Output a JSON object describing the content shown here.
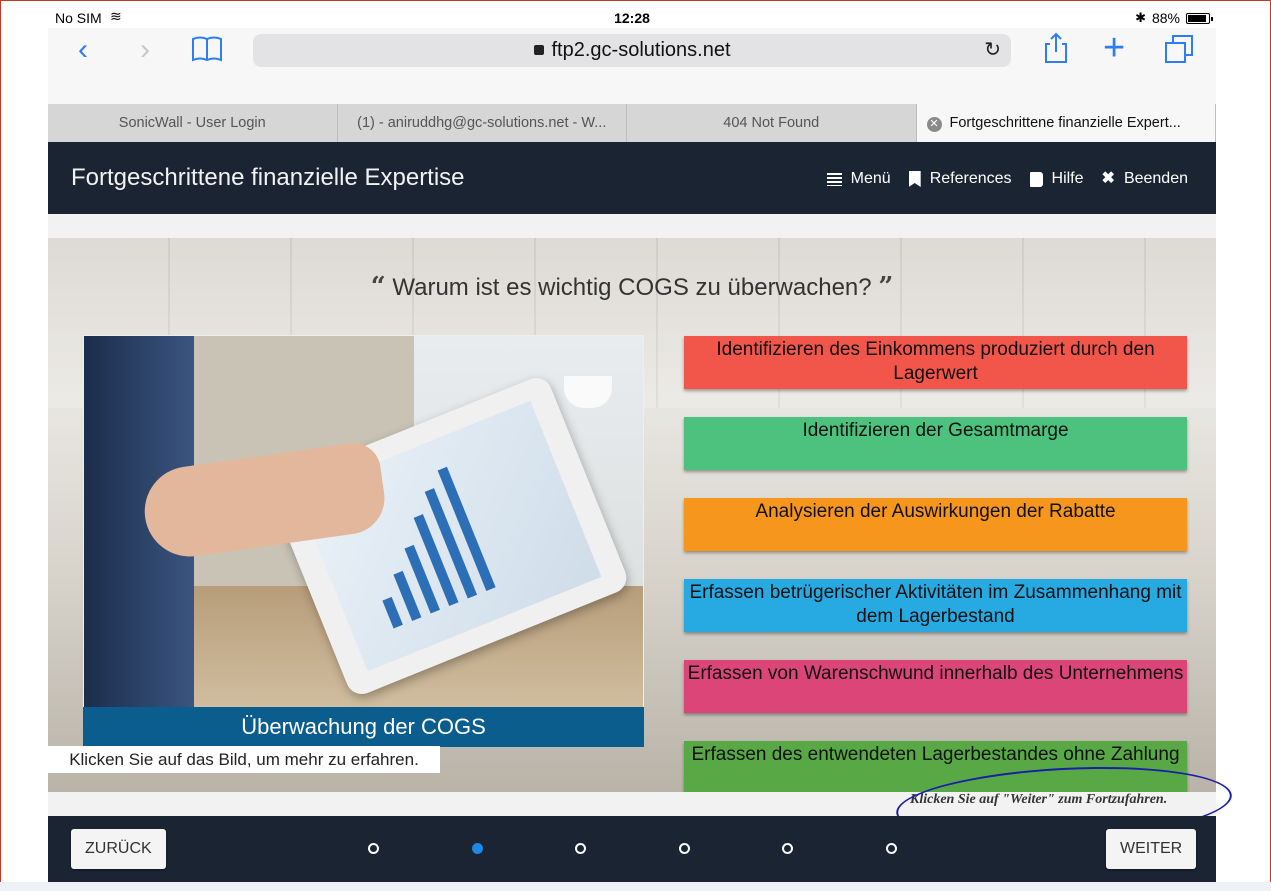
{
  "status_bar": {
    "carrier": "No SIM",
    "time": "12:28",
    "battery": "88%"
  },
  "browser": {
    "url": "ftp2.gc-solutions.net",
    "tabs": [
      {
        "label": "SonicWall - User Login",
        "active": false
      },
      {
        "label": "(1) - aniruddhg@gc-solutions.net - W...",
        "active": false
      },
      {
        "label": "404 Not Found",
        "active": false
      },
      {
        "label": "Fortgeschrittene finanzielle Expert...",
        "active": true
      }
    ]
  },
  "course": {
    "title": "Fortgeschrittene finanzielle Expertise",
    "nav": {
      "menu": "Menü",
      "references": "References",
      "help": "Hilfe",
      "exit": "Beenden"
    }
  },
  "slide": {
    "question": "Warum ist es wichtig COGS zu überwachen?",
    "image_caption": "Überwachung der COGS",
    "image_hint": "Klicken Sie auf das Bild, um mehr zu erfahren.",
    "options": [
      {
        "label": "Identifizieren des Einkommens produziert durch den Lagerwert",
        "color": "#f2564a"
      },
      {
        "label": "Identifizieren der Gesamtmarge",
        "color": "#4cc27e"
      },
      {
        "label": "Analysieren der Auswirkungen der Rabatte",
        "color": "#f7961d"
      },
      {
        "label": "Erfassen betrügerischer Aktivitäten im Zusammenhang mit dem Lagerbestand",
        "color": "#27a9e1"
      },
      {
        "label": "Erfassen von Warenschwund innerhalb des Unternehmens",
        "color": "#dc4577"
      },
      {
        "label": "Erfassen des entwendeten Lagerbestandes ohne Zahlung",
        "color": "#58a845"
      }
    ],
    "continue_hint": "Klicken Sie auf \"Weiter\" zum Fortzufahren."
  },
  "footer": {
    "back": "ZURÜCK",
    "next": "WEITER",
    "pages": 6,
    "current_page": 2
  },
  "colors": {
    "header_bg": "#1b2433",
    "caption_bg": "#0b5d8e",
    "accent": "#2d7df6",
    "active_dot": "#1e88e5",
    "annotation": "#1a1fa8"
  }
}
